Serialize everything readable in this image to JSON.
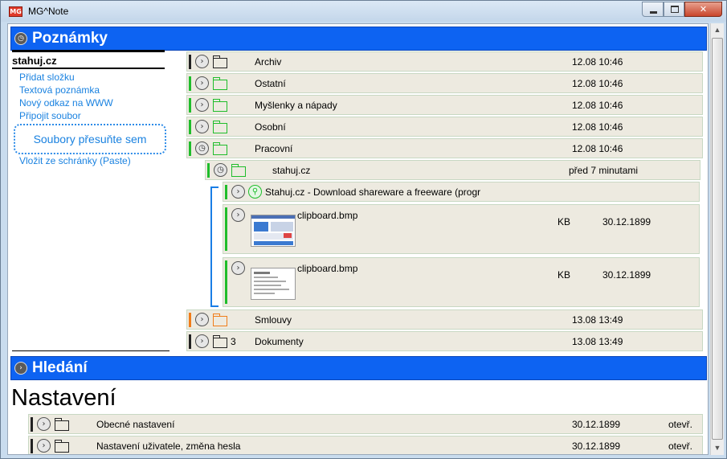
{
  "window": {
    "title": "MG^Note",
    "app_icon_text": "MG"
  },
  "notes_section": {
    "title": "Poznámky"
  },
  "left_panel": {
    "title": "stahuj.cz",
    "links": [
      "Přidat složku",
      "Textová poznámka",
      "Nový odkaz na WWW",
      "Připojit soubor"
    ],
    "dropzone": "Soubory přesuňte sem",
    "paste": "Vložit ze schránky (Paste)"
  },
  "folders": [
    {
      "name": "Archiv",
      "date": "12.08 10:46",
      "color": "#222222",
      "stripe": "#222222",
      "expanded": false
    },
    {
      "name": "Ostatní",
      "date": "12.08 10:46",
      "color": "#1fbd2b",
      "stripe": "#1fbd2b",
      "expanded": false
    },
    {
      "name": "Myšlenky a nápady",
      "date": "12.08 10:46",
      "color": "#1fbd2b",
      "stripe": "#1fbd2b",
      "expanded": false
    },
    {
      "name": "Osobní",
      "date": "12.08 10:46",
      "color": "#1fbd2b",
      "stripe": "#1fbd2b",
      "expanded": false
    },
    {
      "name": "Pracovní",
      "date": "12.08 10:46",
      "color": "#1fbd2b",
      "stripe": "#1fbd2b",
      "expanded": true
    }
  ],
  "subfolder": {
    "name": "stahuj.cz",
    "date": "před 7 minutami"
  },
  "link_item": {
    "name": "Stahuj.cz - Download shareware a freeware (progr"
  },
  "files": [
    {
      "name": "clipboard.bmp",
      "size": "KB",
      "date": "30.12.1899"
    },
    {
      "name": "clipboard.bmp",
      "size": "KB",
      "date": "30.12.1899"
    }
  ],
  "folders_after": [
    {
      "name": "Smlouvy",
      "date": "13.08 13:49",
      "count": "",
      "color": "#f07d1a",
      "stripe": "#f07d1a"
    },
    {
      "name": "Dokumenty",
      "date": "13.08 13:49",
      "count": "3",
      "color": "#222222",
      "stripe": "#222222"
    }
  ],
  "search_section": {
    "title": "Hledání"
  },
  "settings": {
    "title": "Nastavení",
    "rows": [
      {
        "name": "Obecné nastavení",
        "date": "30.12.1899",
        "action": "otevř."
      },
      {
        "name": "Nastavení uživatele, změna hesla",
        "date": "30.12.1899",
        "action": "otevř."
      }
    ]
  },
  "icons": {
    "expand": "chevron-right-icon",
    "collapse": "collapse-icon",
    "folder": "folder-icon",
    "link": "link-icon",
    "thumbnail": "image-thumbnail"
  },
  "colors": {
    "section_bar": "#0d63f2",
    "link_text": "#1a82e0",
    "row_bg": "#edeae0",
    "green": "#1fbd2b",
    "orange": "#f07d1a"
  }
}
